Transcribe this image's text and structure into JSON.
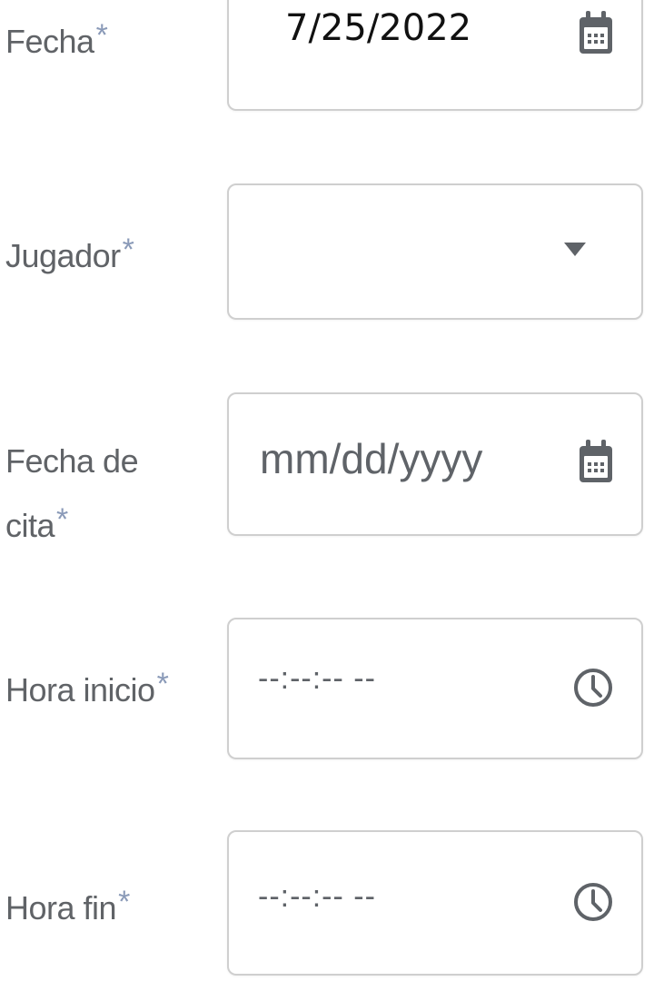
{
  "form": {
    "fecha": {
      "label": "Fecha",
      "required_mark": "*",
      "value": "7/25/2022",
      "icon": "calendar-icon"
    },
    "jugador": {
      "label": "Jugador",
      "required_mark": "*",
      "value": "",
      "icon": "chevron-down-icon"
    },
    "fecha_cita": {
      "label_line1": "Fecha de",
      "label_line2": "cita",
      "required_mark": "*",
      "placeholder": "mm/dd/yyyy",
      "icon": "calendar-icon"
    },
    "hora_inicio": {
      "label": "Hora inicio",
      "required_mark": "*",
      "placeholder": "--:--:-- --",
      "icon": "clock-icon"
    },
    "hora_fin": {
      "label": "Hora fin",
      "required_mark": "*",
      "placeholder": "--:--:-- --",
      "icon": "clock-icon"
    }
  },
  "colors": {
    "label": "#606367",
    "required_mark": "#8a9ab8",
    "field_border": "#cfcfcf",
    "icon": "#5f6368",
    "value_text": "#111111"
  }
}
